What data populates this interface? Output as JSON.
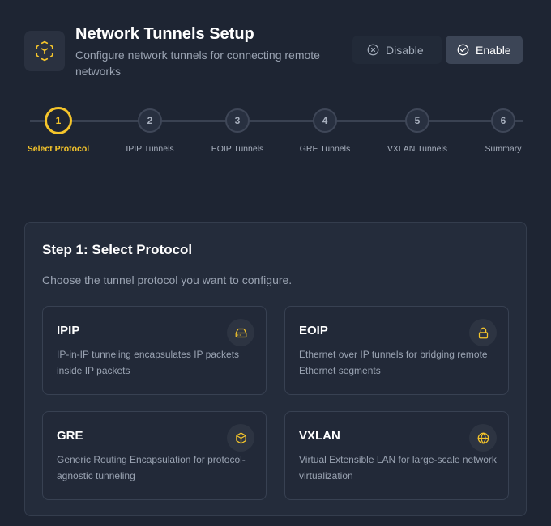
{
  "header": {
    "title": "Network Tunnels Setup",
    "subtitle": "Configure network tunnels for connecting remote networks",
    "logo_icon": "network-nodes-icon",
    "disable_label": "Disable",
    "enable_label": "Enable"
  },
  "stepper": {
    "active_step": 1,
    "steps": [
      {
        "number": "1",
        "label": "Select Protocol"
      },
      {
        "number": "2",
        "label": "IPIP Tunnels"
      },
      {
        "number": "3",
        "label": "EOIP Tunnels"
      },
      {
        "number": "4",
        "label": "GRE Tunnels"
      },
      {
        "number": "5",
        "label": "VXLAN Tunnels"
      },
      {
        "number": "6",
        "label": "Summary"
      }
    ]
  },
  "panel": {
    "title": "Step 1: Select Protocol",
    "description": "Choose the tunnel protocol you want to configure.",
    "protocols": [
      {
        "name": "IPIP",
        "description": "IP-in-IP tunneling encapsulates IP packets inside IP packets",
        "icon": "hard-drive-icon"
      },
      {
        "name": "EOIP",
        "description": "Ethernet over IP tunnels for bridging remote Ethernet segments",
        "icon": "lock-icon"
      },
      {
        "name": "GRE",
        "description": "Generic Routing Encapsulation for protocol-agnostic tunneling",
        "icon": "cube-icon"
      },
      {
        "name": "VXLAN",
        "description": "Virtual Extensible LAN for large-scale network virtualization",
        "icon": "globe-icon"
      }
    ]
  },
  "colors": {
    "background": "#1e2533",
    "accent": "#f5c52b",
    "panel": "#242c3b",
    "card": "#222938"
  }
}
